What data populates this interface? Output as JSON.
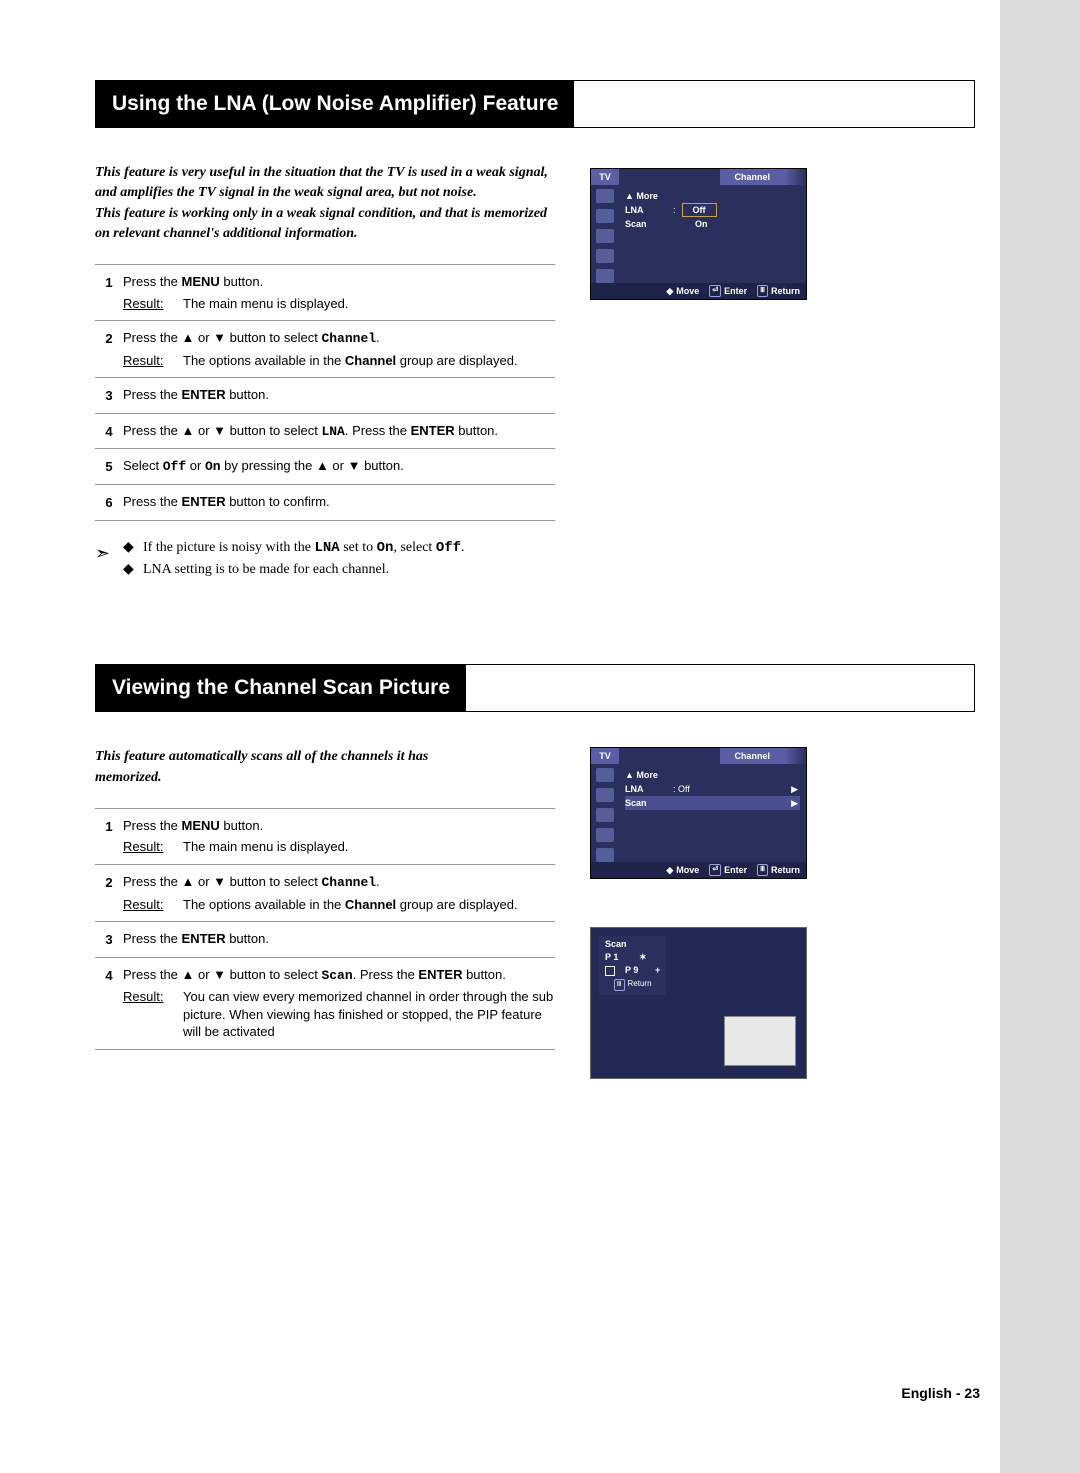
{
  "section1": {
    "title": "Using the LNA (Low Noise Amplifier) Feature",
    "intro1": "This feature is very useful in the situation that the TV is used in a weak signal, and amplifies the TV signal in the weak signal area, but not noise.",
    "intro2": "This feature is working only in a weak signal condition, and that is memorized on relevant channel's additional information.",
    "steps": [
      {
        "num": "1",
        "line_pre": "Press the ",
        "line_bold": "MENU",
        "line_post": " button.",
        "result": "The main menu is displayed."
      },
      {
        "num": "2",
        "line_pre": "Press the ▲ or ▼ button to select ",
        "line_tt": "Channel",
        "line_post2": ".",
        "result": "The options available in the ",
        "result_bold": "Channel",
        "result_post": " group are displayed."
      },
      {
        "num": "3",
        "line_pre": "Press the ",
        "line_bold": "ENTER",
        "line_post": " button."
      },
      {
        "num": "4",
        "line_pre": "Press the ▲ or ▼ button to select ",
        "line_tt": "LNA",
        "line_mid": ". Press the ",
        "line_bold2": "ENTER",
        "line_post3": " button."
      },
      {
        "num": "5",
        "line_pre": "Select ",
        "tt1": "Off",
        "mid": " or ",
        "tt2": "On",
        "post": "  by pressing the ▲ or ▼ button."
      },
      {
        "num": "6",
        "line_pre": "Press the ",
        "line_bold": "ENTER",
        "line_post": " button to confirm."
      }
    ],
    "notes": {
      "a_pre": "If the picture is noisy with the ",
      "a_tt1": "LNA",
      "a_mid": " set to ",
      "a_tt2": "On",
      "a_mid2": ", select ",
      "a_tt3": "Off",
      "a_post": ".",
      "b": "LNA setting is to be made for each channel."
    }
  },
  "section2": {
    "title": "Viewing the Channel Scan Picture",
    "intro": "This feature automatically scans all of the channels it has memorized.",
    "steps": [
      {
        "num": "1",
        "line_pre": "Press the ",
        "line_bold": "MENU",
        "line_post": " button.",
        "result": "The main menu is displayed."
      },
      {
        "num": "2",
        "line_pre": "Press the ▲ or ▼ button to select ",
        "line_tt": "Channel",
        "line_post2": ".",
        "result": "The options available in the ",
        "result_bold": "Channel",
        "result_post": " group are displayed."
      },
      {
        "num": "3",
        "line_pre": "Press the ",
        "line_bold": "ENTER",
        "line_post": " button."
      },
      {
        "num": "4",
        "line_pre": "Press the ▲ or ▼ button to select ",
        "line_tt": "Scan",
        "line_mid": ". Press the ",
        "line_bold2": "ENTER",
        "line_post3": " button.",
        "result": "You can view every memorized channel in order through the sub picture. When viewing has finished or stopped, the PIP feature will be activated"
      }
    ]
  },
  "osd": {
    "tv": "TV",
    "title": "Channel",
    "more": "▲ More",
    "lna": "LNA",
    "scan": "Scan",
    "off": "Off",
    "on": "On",
    "colon": ":",
    "move": "Move",
    "enter": "Enter",
    "return": "Return",
    "off_val": ": Off",
    "arrow": "▶"
  },
  "scanpanel": {
    "title": "Scan",
    "p1": "P  1",
    "p9": "P  9",
    "star": "✶",
    "plus": "+",
    "return": "Return"
  },
  "footer": "English - 23",
  "result_label": "Result:"
}
